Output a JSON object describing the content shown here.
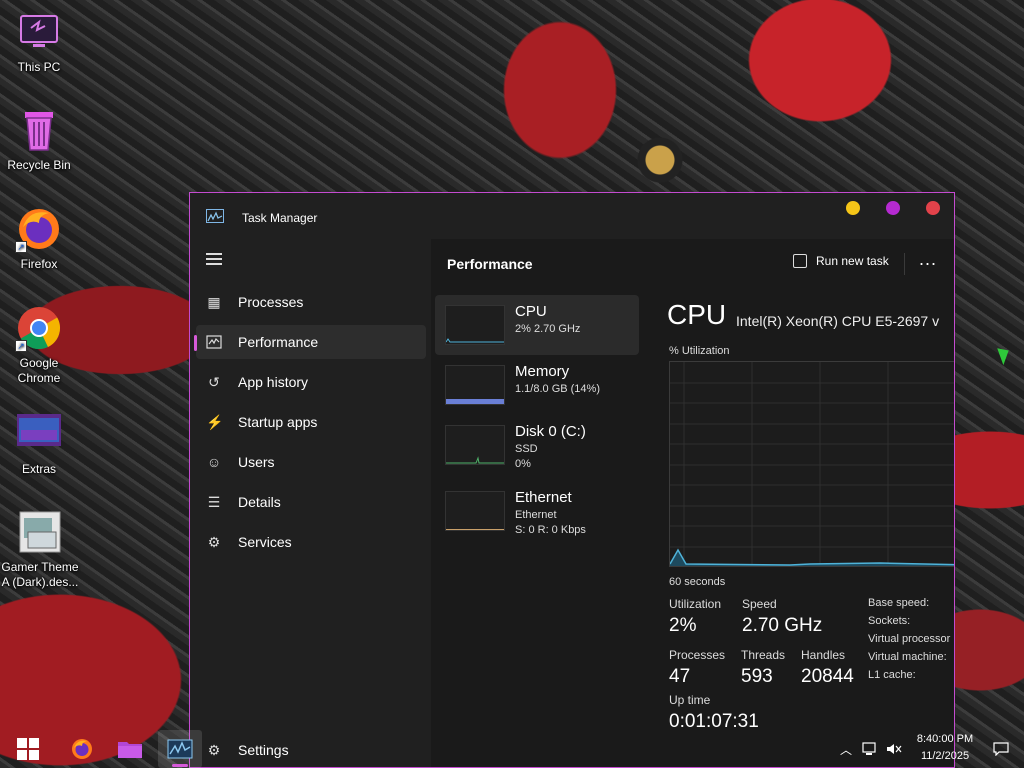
{
  "desktop": {
    "icons": [
      {
        "label": "This PC"
      },
      {
        "label": "Recycle Bin"
      },
      {
        "label": "Firefox"
      },
      {
        "label": "Google Chrome"
      },
      {
        "label": "Extras"
      },
      {
        "label": "Gamer Theme A (Dark).des..."
      }
    ]
  },
  "window": {
    "title": "Task Manager",
    "controls": {
      "minimize_color": "#f5c518",
      "maximize_color": "#b52ad1",
      "close_color": "#e2424a"
    }
  },
  "sidebar": {
    "items": [
      {
        "label": "Processes",
        "icon": "processes-icon"
      },
      {
        "label": "Performance",
        "icon": "performance-icon",
        "active": true
      },
      {
        "label": "App history",
        "icon": "history-icon"
      },
      {
        "label": "Startup apps",
        "icon": "startup-icon"
      },
      {
        "label": "Users",
        "icon": "users-icon"
      },
      {
        "label": "Details",
        "icon": "details-icon"
      },
      {
        "label": "Services",
        "icon": "services-icon"
      }
    ],
    "settings_label": "Settings"
  },
  "header": {
    "title": "Performance",
    "run_new_task": "Run new task",
    "more": "..."
  },
  "resources": [
    {
      "name": "CPU",
      "sub1": "2% 2.70 GHz",
      "sub2": ""
    },
    {
      "name": "Memory",
      "sub1": "1.1/8.0 GB (14%)",
      "sub2": ""
    },
    {
      "name": "Disk 0 (C:)",
      "sub1": "SSD",
      "sub2": "0%"
    },
    {
      "name": "Ethernet",
      "sub1": "Ethernet",
      "sub2": "S: 0 R: 0 Kbps"
    }
  ],
  "cpu": {
    "title": "CPU",
    "model": "Intel(R) Xeon(R) CPU E5-2697 v",
    "utilization_label": "% Utilization",
    "time_window": "60 seconds",
    "stats": {
      "utilization_label": "Utilization",
      "utilization": "2%",
      "speed_label": "Speed",
      "speed": "2.70 GHz",
      "processes_label": "Processes",
      "processes": "47",
      "threads_label": "Threads",
      "threads": "593",
      "handles_label": "Handles",
      "handles": "20844",
      "uptime_label": "Up time",
      "uptime": "0:01:07:31"
    },
    "specs": [
      "Base speed:",
      "Sockets:",
      "Virtual processor",
      "Virtual machine:",
      "L1 cache:"
    ],
    "accent_color": "#4fb3d9"
  },
  "taskbar": {
    "time": "8:40:00 PM",
    "date": "11/2/2025"
  }
}
